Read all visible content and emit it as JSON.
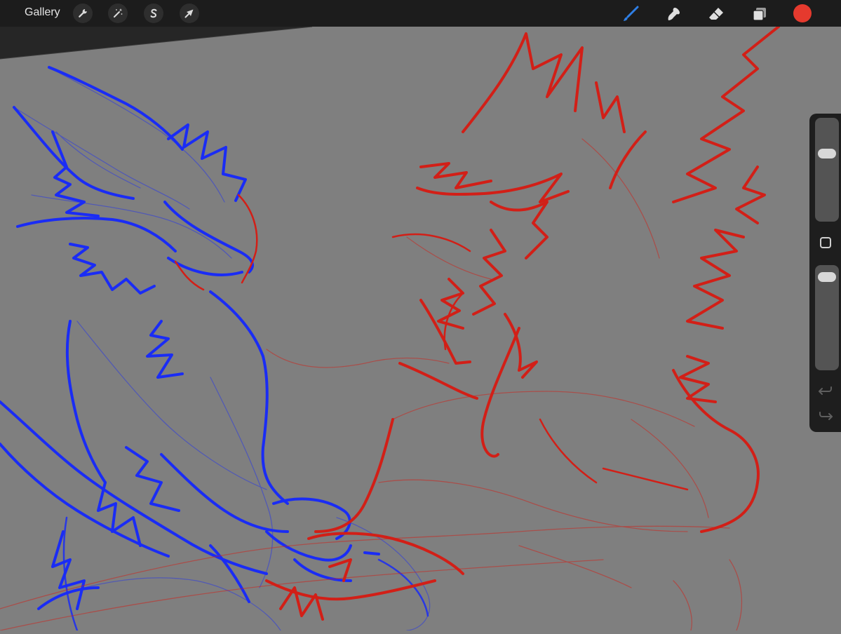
{
  "toolbar": {
    "gallery_label": "Gallery",
    "actions_icon": "wrench-icon",
    "adjustments_icon": "magic-wand-icon",
    "selection_icon": "s-selection-icon",
    "transform_icon": "arrow-cursor-icon",
    "brush_icon": "brush-icon",
    "smudge_icon": "smudge-icon",
    "eraser_icon": "eraser-icon",
    "layers_icon": "layers-icon",
    "active_color": "#e53a2e",
    "active_tool_color": "#2f7fe5"
  },
  "sidebar": {
    "brush_size_level": 0.68,
    "opacity_level": 0.95,
    "undo_icon": "undo-icon",
    "redo_icon": "redo-icon"
  },
  "canvas": {
    "background": "#7f7f7f",
    "layer_colors": [
      "#1a2cf5",
      "#d21f17"
    ]
  }
}
